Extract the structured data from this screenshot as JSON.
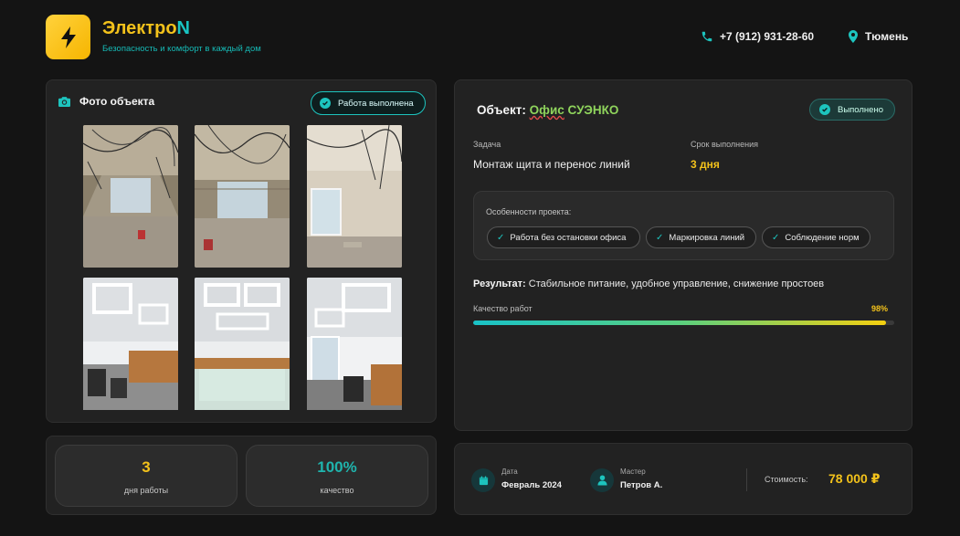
{
  "header": {
    "brand_main": "Электро",
    "brand_accent": "N",
    "tagline": "Безопасность и комфорт в каждый дом",
    "phone": "+7 (912) 931-28-60",
    "city": "Тюмень"
  },
  "photos": {
    "title": "Фото объекта",
    "badge": "Работа выполнена",
    "items": [
      {
        "label": "construction-room-1"
      },
      {
        "label": "construction-room-2"
      },
      {
        "label": "construction-room-3"
      },
      {
        "label": "finished-office-1"
      },
      {
        "label": "finished-office-2"
      },
      {
        "label": "finished-office-3"
      }
    ]
  },
  "object": {
    "title_prefix": "Объект:",
    "title_name_a": "Офис",
    "title_name_b": " СУЭНКО",
    "status_badge": "Выполнено",
    "task_label": "Задача",
    "task_value": "Монтаж щита и перенос линий",
    "term_label": "Срок выполнения",
    "term_value": "3 дня",
    "features_label": "Особенности проекта:",
    "features": [
      "Работа без остановки офиса",
      "Маркировка линий",
      "Соблюдение норм"
    ],
    "result_label": "Результат:",
    "result_text": " Стабильное питание, удобное управление, снижение простоев",
    "quality_label": "Качество работ",
    "quality_percent": "98%",
    "quality_value": 0.98
  },
  "stats": [
    {
      "number": "3",
      "label": "дня работы",
      "color": "#f3c21b"
    },
    {
      "number": "100%",
      "label": "качество",
      "color": "#1fb4ad"
    }
  ],
  "meta": {
    "date_label": "Дата",
    "date_value": "Февраль 2024",
    "master_label": "Мастер",
    "master_value": "Петров А.",
    "price_label": "Стоимость:",
    "price_value": "78 000 ₽"
  },
  "colors": {
    "accent_yellow": "#f3c21b",
    "accent_teal": "#1dc4be",
    "background": "#141414"
  }
}
